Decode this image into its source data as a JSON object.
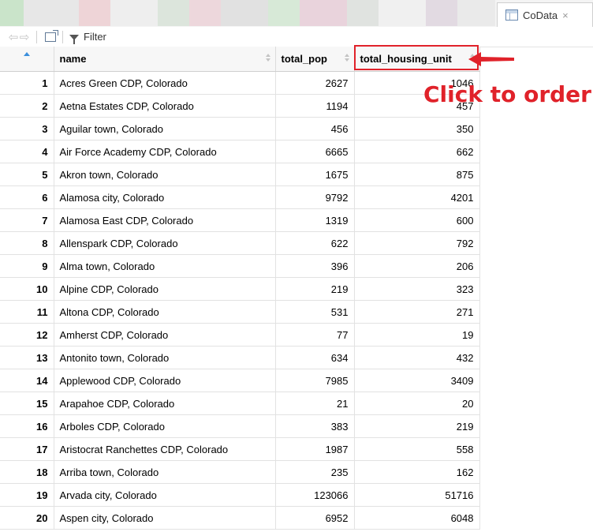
{
  "tab": {
    "title": "CoData",
    "close": "×"
  },
  "toolbar": {
    "back": "⇦",
    "forward": "⇨",
    "filter_label": "Filter"
  },
  "table": {
    "headers": {
      "rownum": "",
      "name": "name",
      "total_pop": "total_pop",
      "total_housing_unit": "total_housing_unit"
    },
    "rows": [
      [
        "1",
        "Acres Green CDP, Colorado",
        "2627",
        "1046"
      ],
      [
        "2",
        "Aetna Estates CDP, Colorado",
        "1194",
        "457"
      ],
      [
        "3",
        "Aguilar town, Colorado",
        "456",
        "350"
      ],
      [
        "4",
        "Air Force Academy CDP, Colorado",
        "6665",
        "662"
      ],
      [
        "5",
        "Akron town, Colorado",
        "1675",
        "875"
      ],
      [
        "6",
        "Alamosa city, Colorado",
        "9792",
        "4201"
      ],
      [
        "7",
        "Alamosa East CDP, Colorado",
        "1319",
        "600"
      ],
      [
        "8",
        "Allenspark CDP, Colorado",
        "622",
        "792"
      ],
      [
        "9",
        "Alma town, Colorado",
        "396",
        "206"
      ],
      [
        "10",
        "Alpine CDP, Colorado",
        "219",
        "323"
      ],
      [
        "11",
        "Altona CDP, Colorado",
        "531",
        "271"
      ],
      [
        "12",
        "Amherst CDP, Colorado",
        "77",
        "19"
      ],
      [
        "13",
        "Antonito town, Colorado",
        "634",
        "432"
      ],
      [
        "14",
        "Applewood CDP, Colorado",
        "7985",
        "3409"
      ],
      [
        "15",
        "Arapahoe CDP, Colorado",
        "21",
        "20"
      ],
      [
        "16",
        "Arboles CDP, Colorado",
        "383",
        "219"
      ],
      [
        "17",
        "Aristocrat Ranchettes CDP, Colorado",
        "1987",
        "558"
      ],
      [
        "18",
        "Arriba town, Colorado",
        "235",
        "162"
      ],
      [
        "19",
        "Arvada city, Colorado",
        "123066",
        "51716"
      ],
      [
        "20",
        "Aspen city, Colorado",
        "6952",
        "6048"
      ]
    ]
  },
  "annotation": {
    "text": "Click to order",
    "color": "#e0222a"
  },
  "colors": {
    "sort_indicator": "#3b8fdc",
    "header_bg": "#f7f7f7"
  }
}
